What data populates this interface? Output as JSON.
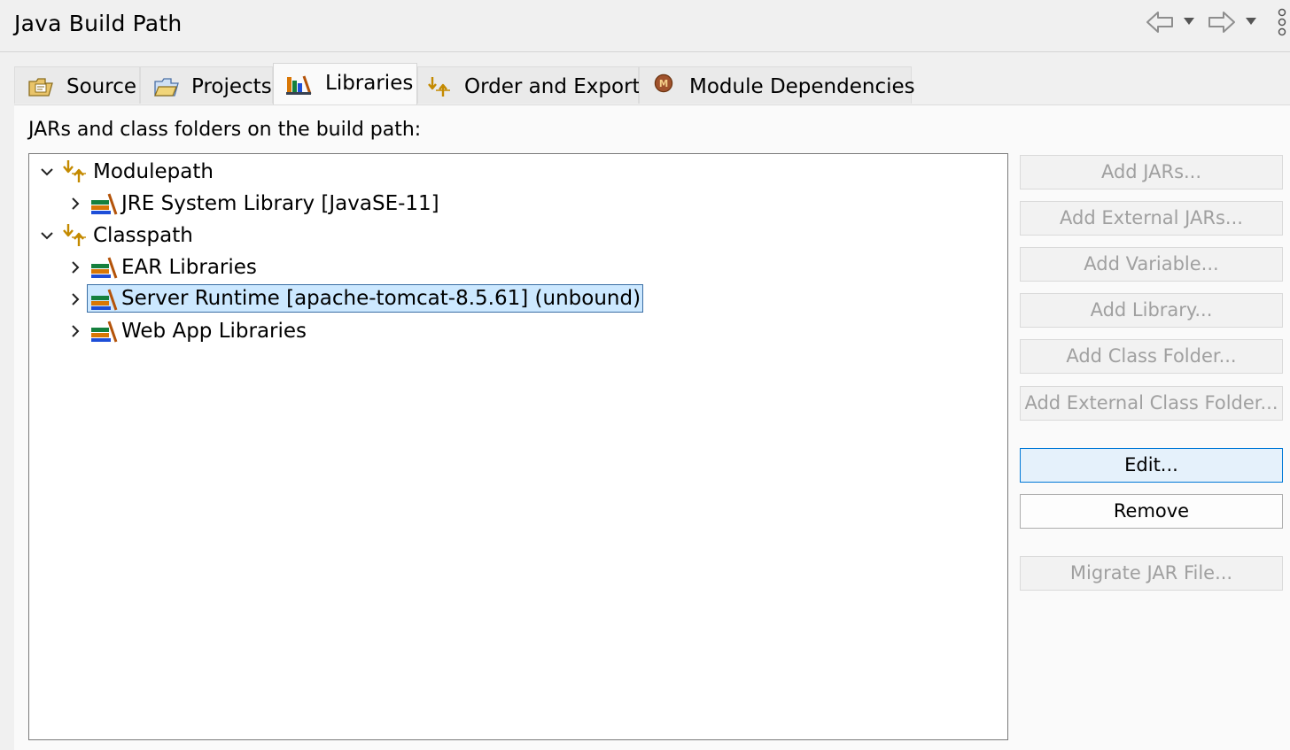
{
  "window": {
    "title": "Java Build Path"
  },
  "toolbar": {
    "back_icon": "back-arrow-icon",
    "forward_icon": "forward-arrow-icon",
    "menu_icon": "view-menu-icon"
  },
  "tabs": [
    {
      "label": "Source",
      "icon": "source-folder-icon",
      "active": false
    },
    {
      "label": "Projects",
      "icon": "project-folder-icon",
      "active": false
    },
    {
      "label": "Libraries",
      "icon": "library-icon",
      "active": true
    },
    {
      "label": "Order and Export",
      "icon": "order-export-icon",
      "active": false
    },
    {
      "label": "Module Dependencies",
      "icon": "module-icon",
      "active": false
    }
  ],
  "libraries": {
    "heading": "JARs and class folders on the build path:",
    "tree": [
      {
        "label": "Modulepath",
        "icon": "path-container-icon",
        "expanded": true,
        "level": 0
      },
      {
        "label": "JRE System Library [JavaSE-11]",
        "icon": "library-icon",
        "expanded": false,
        "level": 1
      },
      {
        "label": "Classpath",
        "icon": "path-container-icon",
        "expanded": true,
        "level": 0
      },
      {
        "label": "EAR Libraries",
        "icon": "library-icon",
        "expanded": false,
        "level": 1
      },
      {
        "label": "Server Runtime [apache-tomcat-8.5.61] (unbound)",
        "icon": "library-icon",
        "expanded": false,
        "level": 1,
        "selected": true
      },
      {
        "label": "Web App Libraries",
        "icon": "library-icon",
        "expanded": false,
        "level": 1
      }
    ],
    "buttons": [
      {
        "label": "Add JARs...",
        "enabled": false
      },
      {
        "label": "Add External JARs...",
        "enabled": false
      },
      {
        "label": "Add Variable...",
        "enabled": false
      },
      {
        "label": "Add Library...",
        "enabled": false
      },
      {
        "label": "Add Class Folder...",
        "enabled": false
      },
      {
        "label": "Add External Class Folder...",
        "enabled": false
      },
      {
        "label": "Edit...",
        "enabled": true,
        "focused": true
      },
      {
        "label": "Remove",
        "enabled": true
      },
      {
        "label": "Migrate JAR File...",
        "enabled": false
      }
    ]
  },
  "colors": {
    "selection_bg": "#cce8ff",
    "selection_border": "#3a6ea5",
    "focus_border": "#0078d7",
    "disabled_text": "#a0a0a0"
  }
}
